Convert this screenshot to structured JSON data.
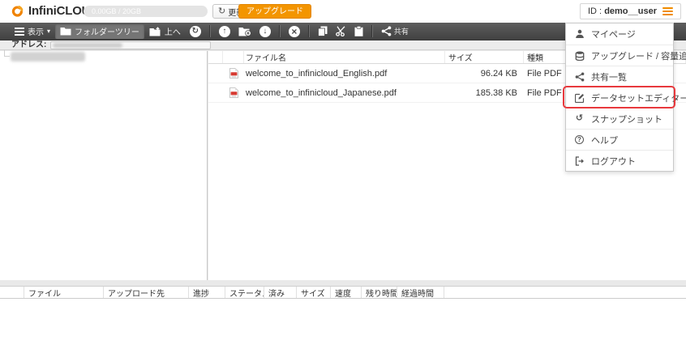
{
  "header": {
    "logo_text": "InfiniCLOUD",
    "capacity_text": "0.00GB / 20GB",
    "refresh_label": "更新",
    "upgrade_label": "アップグレード",
    "id_prefix": "ID :",
    "id_value": "demo__user"
  },
  "toolbar": {
    "view_label": "表示",
    "folder_tree_label": "フォルダーツリー",
    "up_label": "上へ",
    "share_label": "共有"
  },
  "icons": {
    "caret_down": "▾",
    "refresh": "↻",
    "sync": "↻",
    "upload": "↑",
    "download": "↓",
    "delete": "×",
    "history": "↺",
    "help": "?"
  },
  "address": {
    "label": "アドレス:"
  },
  "file_list": {
    "columns": {
      "name": "ファイル名",
      "size": "サイズ",
      "type": "種類"
    },
    "rows": [
      {
        "name": "welcome_to_infinicloud_English.pdf",
        "size": "96.24 KB",
        "type": "File PDF"
      },
      {
        "name": "welcome_to_infinicloud_Japanese.pdf",
        "size": "185.38 KB",
        "type": "File PDF"
      }
    ]
  },
  "transfer_panel": {
    "columns": [
      "ファイル",
      "アップロード先",
      "進捗",
      "ステータス",
      "済み",
      "サイズ",
      "速度",
      "残り時間",
      "経過時間"
    ]
  },
  "account_menu": {
    "items": [
      {
        "label": "マイページ",
        "icon": "user-icon"
      },
      {
        "label": "アップグレード / 容量追加",
        "icon": "capacity-icon"
      },
      {
        "label": "共有一覧",
        "icon": "share-icon"
      },
      {
        "label": "データセットエディター",
        "icon": "edit-icon",
        "highlighted": true
      },
      {
        "label": "スナップショット",
        "icon": "history-icon"
      },
      {
        "label": "ヘルプ",
        "icon": "help-icon"
      },
      {
        "label": "ログアウト",
        "icon": "logout-icon"
      }
    ]
  },
  "colors": {
    "brand_orange": "#f08300",
    "button_orange": "#f39500",
    "highlight_red": "#e8393d",
    "toolbar_dark": "#4a4a4a"
  }
}
